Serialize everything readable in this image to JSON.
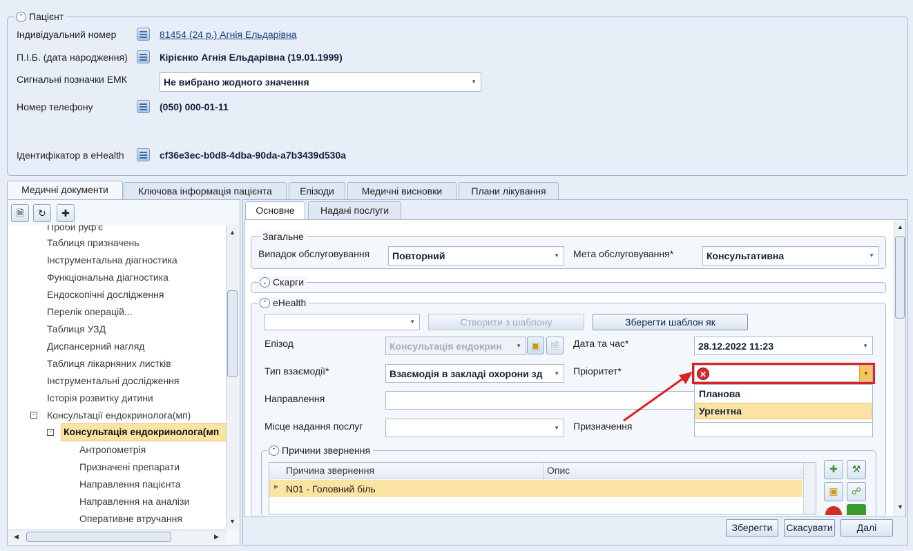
{
  "patient": {
    "title": "Пацієнт",
    "id_label": "Індивідуальний номер",
    "id_value": "81454 (24 р.) Агнія Ельдарівна",
    "name_label": "П.І.Б. (дата народження)",
    "name_value": "Кірієнко Агнія Ельдарівна (19.01.1999)",
    "signals_label": "Сигнальні позначки ЕМК",
    "signals_value": "Не вибрано жодного значення",
    "phone_label": "Номер телефону",
    "phone_value": "(050) 000-01-11",
    "ehealth_label": "Ідентифікатор в eHealth",
    "ehealth_value": "cf36e3ec-b0d8-4dba-90da-a7b3439d530a"
  },
  "main_tabs": [
    "Медичні документи",
    "Ключова інформація пацієнта",
    "Епізоди",
    "Медичні висновки",
    "Плани лікування"
  ],
  "tree": {
    "partial_item": "Проби руф'є",
    "items": [
      "Таблиця призначень",
      "Інструментальна діагностика",
      "Функціональна діагностика",
      "Ендоскопічні дослідження",
      "Перелік операцій...",
      "Таблиця УЗД",
      "Диспансерний нагляд",
      "Таблиця лікарняних листків",
      "Інструментальні дослідження",
      "Історія розвитку дитини"
    ],
    "group": "Консультації ендокринолога(мп)",
    "selected": "Консультація ендокринолога(мп",
    "children": [
      "Антропометрія",
      "Призначені препарати",
      "Направлення пацієнта",
      "Направлення на аналізи",
      "Оперативне втручання"
    ]
  },
  "sub_tabs": [
    "Основне",
    "Надані послуги"
  ],
  "general": {
    "title": "Загальне",
    "case_label": "Випадок обслуговування",
    "case_value": "Повторний",
    "purpose_label": "Мета обслуговування*",
    "purpose_value": "Консультативна"
  },
  "complaints_title": "Скарги",
  "ehealth": {
    "title": "eHealth",
    "template_value": "",
    "create_btn": "Створити з шаблону",
    "save_tpl_btn": "Зберегти шаблон як",
    "episode_label": "Епізод",
    "episode_value": "Консультація ендокрин",
    "datetime_label": "Дата та час*",
    "datetime_value": "28.12.2022 11:23",
    "interaction_label": "Тип взаємодії*",
    "interaction_value": "Взаємодія в закладі охорони зд",
    "priority_label": "Пріоритет*",
    "priority_value": "",
    "priority_options": [
      "Планова",
      "Ургентна"
    ],
    "referral_label": "Направлення",
    "place_label": "Місце надання послуг",
    "appointment_label": "Призначення"
  },
  "reasons": {
    "title": "Причини звернення",
    "columns": [
      "Причина звернення",
      "Опис"
    ],
    "rows": [
      [
        "N01 - Головний біль",
        ""
      ]
    ]
  },
  "buttons": {
    "save": "Зберегти",
    "cancel": "Скасувати",
    "next": "Далі"
  },
  "colors": {
    "accent": "#e02020",
    "selection": "#fbe3a3",
    "background": "#e7eef8"
  }
}
